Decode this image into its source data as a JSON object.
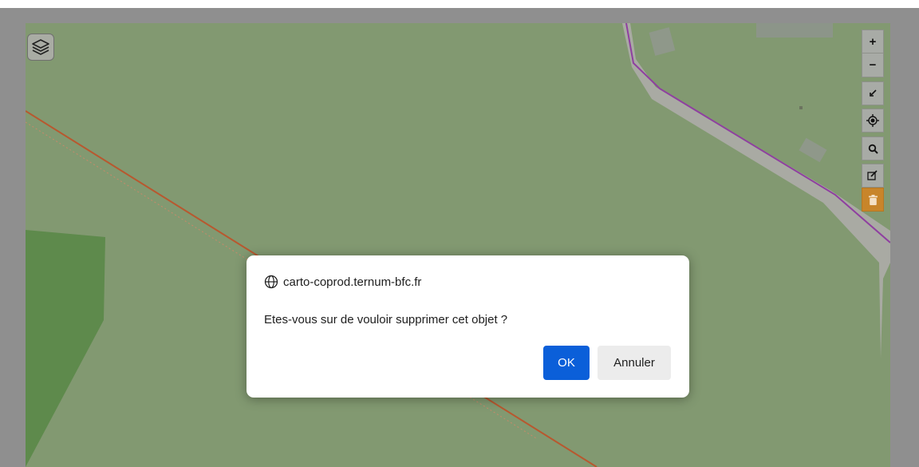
{
  "map": {
    "layers_icon": "layers-icon",
    "colors": {
      "background": "#829971",
      "forest": "#5e8a4c",
      "road_fill": "#a9aaa3",
      "route_line": "#8f3fa0",
      "boundary_line": "#b8582f"
    }
  },
  "toolbar": {
    "zoom_in_label": "+",
    "zoom_out_label": "−",
    "buttons": [
      {
        "name": "zoom-in",
        "icon": "plus-icon"
      },
      {
        "name": "zoom-out",
        "icon": "minus-icon"
      },
      {
        "name": "fullscreen",
        "icon": "collapse-icon"
      },
      {
        "name": "locate",
        "icon": "crosshair-icon"
      },
      {
        "name": "search",
        "icon": "search-icon"
      },
      {
        "name": "edit",
        "icon": "edit-icon"
      },
      {
        "name": "delete",
        "icon": "trash-icon",
        "active": true
      }
    ],
    "active_color": "#c8852a"
  },
  "dialog": {
    "origin": "carto-coprod.ternum-bfc.fr",
    "message": "Etes-vous sur de vouloir supprimer cet objet ?",
    "ok_label": "OK",
    "cancel_label": "Annuler",
    "ok_color": "#0b5fd9"
  }
}
